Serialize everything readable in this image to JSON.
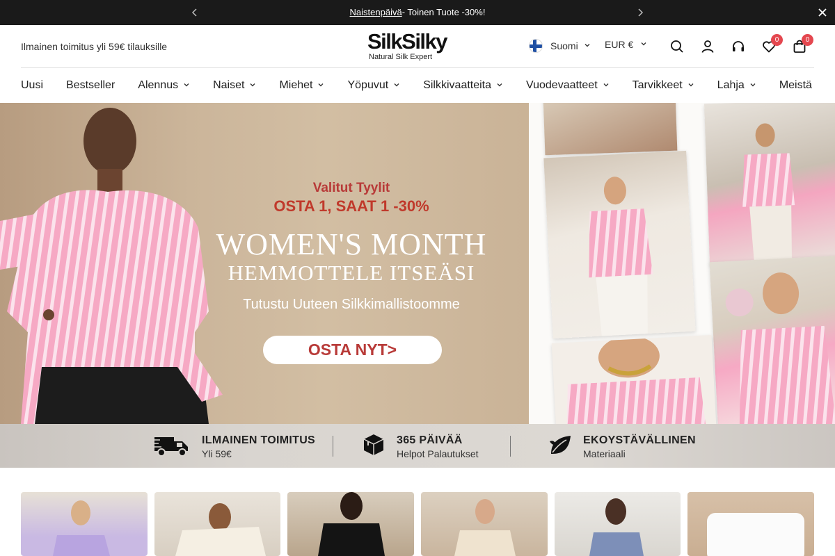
{
  "announcement": {
    "link_text": "Naistenpäivä",
    "rest_text": "- Toinen Tuote -30%!",
    "prev_icon": "chevron-left-icon",
    "next_icon": "chevron-right-icon",
    "close_icon": "close-icon"
  },
  "header": {
    "promo": "Ilmainen toimitus yli 59€ tilauksille",
    "logo": {
      "brand": "SilkSilky",
      "tagline": "Natural Silk Expert"
    },
    "language": "Suomi",
    "currency": "EUR €",
    "wishlist_count": "0",
    "cart_count": "0"
  },
  "nav": {
    "items": [
      {
        "label": "Uusi",
        "dropdown": false
      },
      {
        "label": "Bestseller",
        "dropdown": false
      },
      {
        "label": "Alennus",
        "dropdown": true
      },
      {
        "label": "Naiset",
        "dropdown": true
      },
      {
        "label": "Miehet",
        "dropdown": true
      },
      {
        "label": "Yöpuvut",
        "dropdown": true
      },
      {
        "label": "Silkkivaatteita",
        "dropdown": true
      },
      {
        "label": "Vuodevaatteet",
        "dropdown": true
      },
      {
        "label": "Tarvikkeet",
        "dropdown": true
      },
      {
        "label": "Lahja",
        "dropdown": true
      },
      {
        "label": "Meistä",
        "dropdown": false
      }
    ]
  },
  "hero": {
    "line1": "Valitut Tyylit",
    "line2": "OSTA 1, SAAT 1 -30%",
    "line3": "WOMEN'S MONTH",
    "line4": "HEMMOTTELE ITSEÄSI",
    "line5": "Tutustu Uuteen Silkkimallistoomme",
    "cta": "OSTA NYT>"
  },
  "usp": [
    {
      "title": "ILMAINEN TOIMITUS",
      "subtitle": "Yli 59€",
      "icon": "delivery-truck-icon"
    },
    {
      "title": "365 PÄIVÄÄ",
      "subtitle": "Helpot Palautukset",
      "icon": "package-box-icon"
    },
    {
      "title": "EKOYSTÄVÄLLINEN",
      "subtitle": "Materiaali",
      "icon": "leaf-icon"
    }
  ],
  "colors": {
    "announcement_bg": "#1a1a1a",
    "badge": "#e4474f",
    "hero_accent": "#b83a38"
  }
}
